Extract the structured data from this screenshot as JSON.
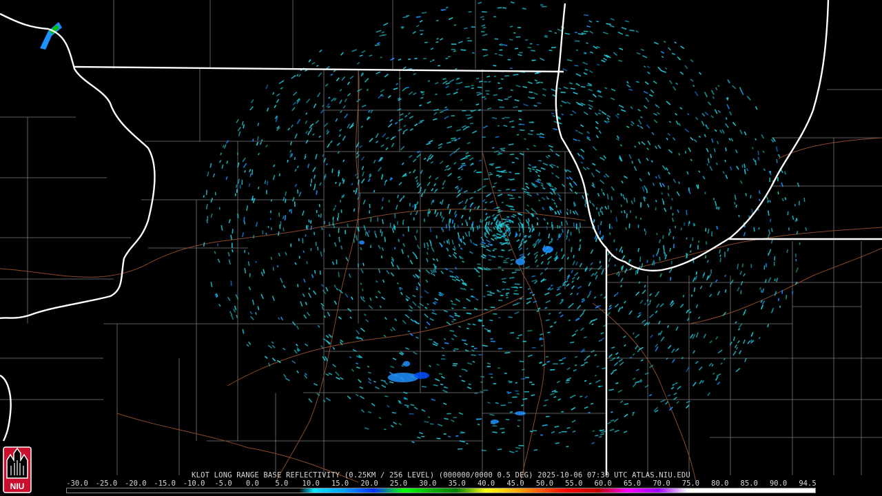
{
  "product": {
    "caption": "KLOT LONG RANGE BASE REFLECTIVITY (0.25KM / 256 LEVEL) (000000/0000 0.5 DEG) 2025-10-06 07:30 UTC  ATLAS.NIU.EDU",
    "station": "KLOT",
    "timestamp": "2025-10-06 07:30 UTC",
    "source": "ATLAS.NIU.EDU"
  },
  "scale": {
    "labels": [
      "-30.0",
      "-25.0",
      "-20.0",
      "-15.0",
      "-10.0",
      "-5.0",
      "0.0",
      "5.0",
      "10.0",
      "15.0",
      "20.0",
      "25.0",
      "30.0",
      "35.0",
      "40.0",
      "45.0",
      "50.0",
      "55.0",
      "60.0",
      "65.0",
      "70.0",
      "75.0",
      "80.0",
      "85.0",
      "90.0",
      "94.5"
    ]
  },
  "logo": {
    "text": "NIU"
  },
  "colors": {
    "background": "#000000",
    "state_border": "#ffffff",
    "county_border": "#808080",
    "road": "#8b4a2b",
    "echo_primary": "#22c8d8",
    "echo_secondary": "#1890ff"
  },
  "echo_clusters": [
    {
      "name": "clutter-field-center",
      "level_dbz": 5
    },
    {
      "name": "echo-southwest",
      "level_dbz": 15
    },
    {
      "name": "echo-northwest-corner",
      "level_dbz": 20
    }
  ]
}
